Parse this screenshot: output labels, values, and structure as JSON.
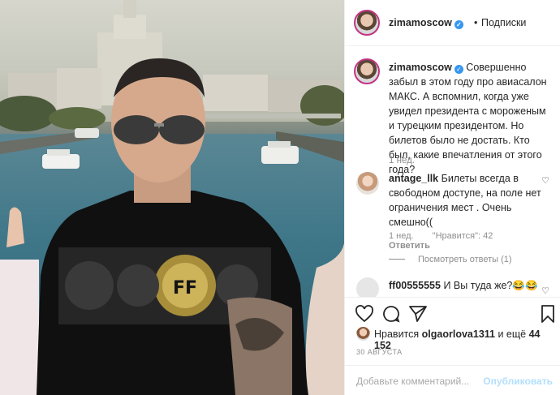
{
  "header": {
    "username": "zimamoscow",
    "separator": "•",
    "follow_label": "Подписки"
  },
  "caption": {
    "username": "zimamoscow",
    "text": "Совершенно забыл в этом году про авиасалон МАКС. А вспомнил, когда уже увидел президента с мороженым и турецким президентом. Но билетов было не достать. Кто был, какие впечатления от этого года?",
    "time": "1 нед."
  },
  "comments": [
    {
      "username": "antage_llk",
      "text": "Билеты всегда в свободном доступе, на поле нет ограничения мест . Очень смешно((",
      "time": "1 нед.",
      "likes": "\"Нравится\": 42",
      "reply_label": "Ответить",
      "view_replies": "Посмотреть ответы (1)"
    },
    {
      "username": "ff00555555",
      "text": "И Вы туда же?😂😂"
    }
  ],
  "actions": {
    "like_icon": "heart-icon",
    "comment_icon": "comment-icon",
    "share_icon": "share-icon",
    "save_icon": "bookmark-icon"
  },
  "likes": {
    "prefix": "Нравится",
    "user": "olgaorlova1311",
    "suffix": "и ещё",
    "count": "44 152"
  },
  "date": "30 АВГУСТА",
  "composer": {
    "placeholder": "Добавьте комментарий...",
    "post_label": "Опубликовать"
  },
  "colors": {
    "verified": "#3897f0",
    "post_disabled": "#b2dffc",
    "story_ring": "#c13584"
  }
}
